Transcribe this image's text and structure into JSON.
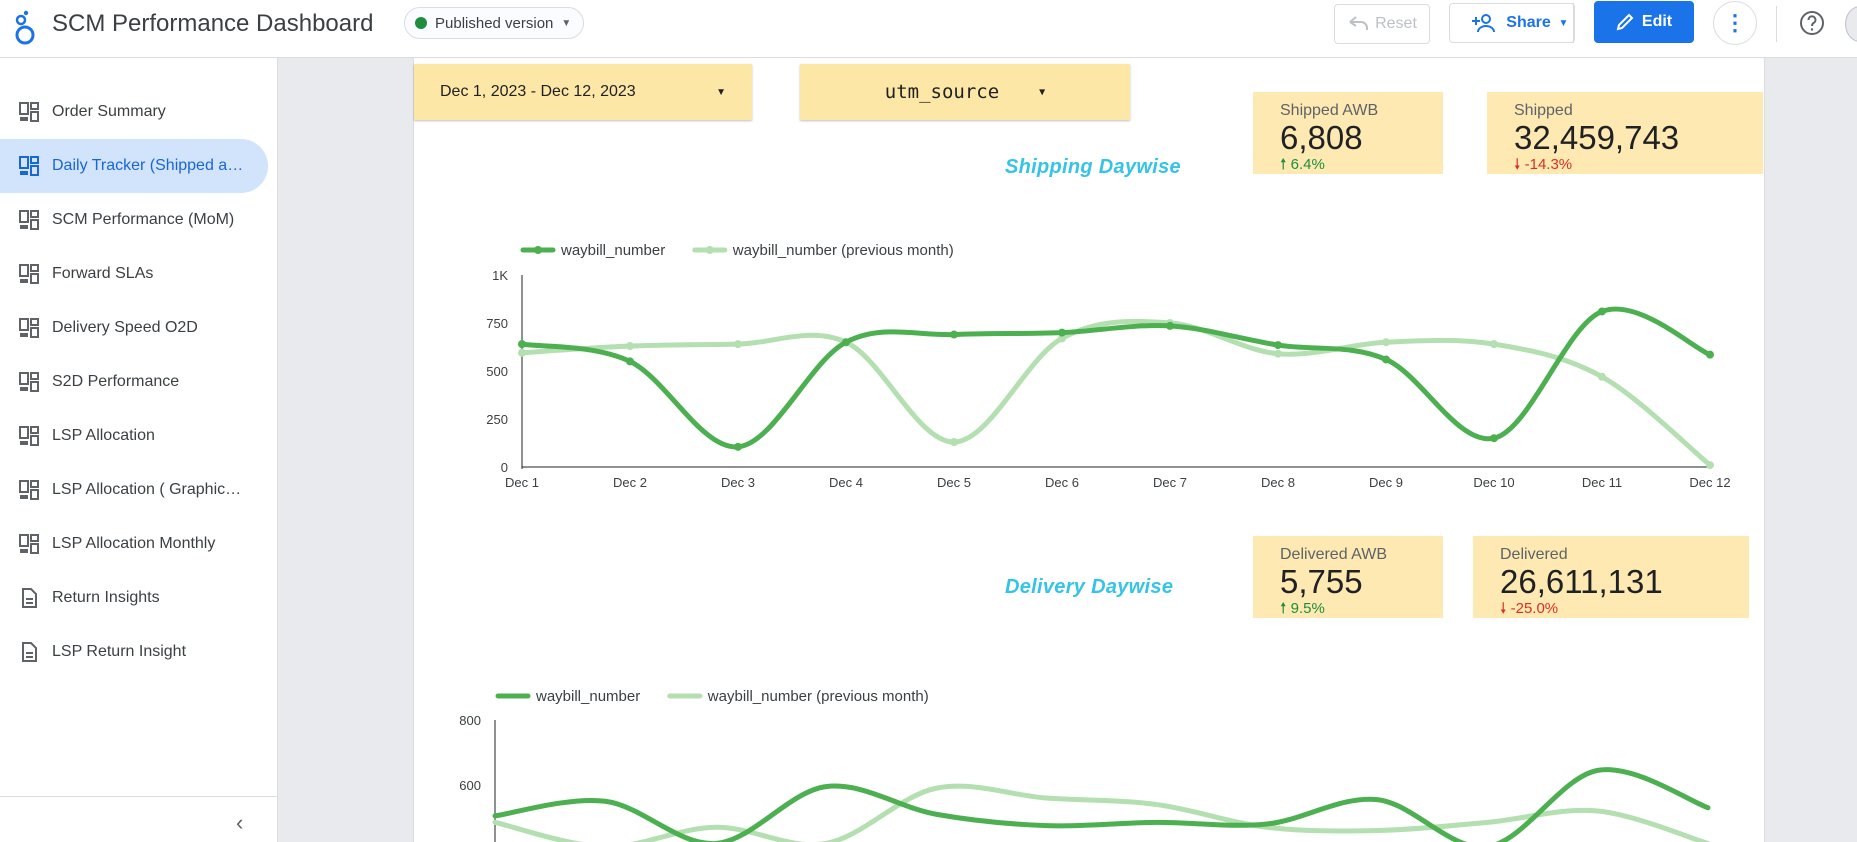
{
  "header": {
    "title": "SCM Performance Dashboard",
    "version_chip": "Published version",
    "reset_label": "Reset",
    "share_label": "Share",
    "edit_label": "Edit"
  },
  "sidebar": {
    "items": [
      {
        "label": "Order Summary",
        "icon": "dashboard-icon"
      },
      {
        "label": "Daily Tracker (Shipped a…",
        "icon": "dashboard-icon",
        "active": true
      },
      {
        "label": "SCM Performance (MoM)",
        "icon": "dashboard-icon"
      },
      {
        "label": "Forward SLAs",
        "icon": "dashboard-icon"
      },
      {
        "label": "Delivery Speed O2D",
        "icon": "dashboard-icon"
      },
      {
        "label": "S2D Performance",
        "icon": "dashboard-icon"
      },
      {
        "label": "LSP Allocation",
        "icon": "dashboard-icon"
      },
      {
        "label": "LSP Allocation ( Graphic…",
        "icon": "dashboard-icon"
      },
      {
        "label": "LSP Allocation Monthly",
        "icon": "dashboard-icon"
      },
      {
        "label": "Return Insights",
        "icon": "document-icon"
      },
      {
        "label": "LSP Return Insight",
        "icon": "document-icon"
      }
    ]
  },
  "controls": {
    "date_range": "Dec 1, 2023 - Dec 12, 2023",
    "dimension": "utm_source"
  },
  "shipping": {
    "title": "Shipping  Daywise",
    "kpis": [
      {
        "label": "Shipped AWB",
        "value": "6,808",
        "delta": "6.4%",
        "direction": "up"
      },
      {
        "label": "Shipped",
        "value": "32,459,743",
        "delta": "-14.3%",
        "direction": "down"
      }
    ]
  },
  "delivery": {
    "title": "Delivery  Daywise",
    "kpis": [
      {
        "label": "Delivered AWB",
        "value": "5,755",
        "delta": "9.5%",
        "direction": "up"
      },
      {
        "label": "Delivered",
        "value": "26,611,131",
        "delta": "-25.0%",
        "direction": "down"
      }
    ]
  },
  "colors": {
    "accent": "#1a73e8",
    "kpi_bg": "#fde9b1",
    "series_current": "#4caf50",
    "series_previous": "#b4dfb0",
    "section_title": "#35c4e6"
  },
  "chart_data": [
    {
      "type": "line",
      "title": "",
      "categories": [
        "Dec 1",
        "Dec 2",
        "Dec 3",
        "Dec 4",
        "Dec 5",
        "Dec 6",
        "Dec 7",
        "Dec 8",
        "Dec 9",
        "Dec 10",
        "Dec 11",
        "Dec 12"
      ],
      "yticks": [
        "0",
        "250",
        "500",
        "750",
        "1K"
      ],
      "ylim": [
        0,
        1000
      ],
      "legend": "top-left",
      "series": [
        {
          "name": "waybill_number",
          "values": [
            640,
            550,
            105,
            650,
            690,
            700,
            735,
            635,
            560,
            150,
            810,
            585
          ]
        },
        {
          "name": "waybill_number (previous month)",
          "values": [
            595,
            630,
            640,
            650,
            130,
            670,
            750,
            590,
            650,
            640,
            470,
            10
          ]
        }
      ]
    },
    {
      "type": "line",
      "title": "",
      "categories": [],
      "yticks": [
        "600",
        "800"
      ],
      "ylim": [
        0,
        800
      ],
      "legend": "top-left",
      "series": [
        {
          "name": "waybill_number",
          "values": [
            505,
            550,
            420,
            595,
            510,
            475,
            485,
            480,
            555,
            410,
            645,
            530
          ]
        },
        {
          "name": "waybill_number (previous month)",
          "values": [
            485,
            410,
            470,
            420,
            590,
            560,
            540,
            470,
            460,
            485,
            520,
            420
          ]
        }
      ]
    }
  ]
}
